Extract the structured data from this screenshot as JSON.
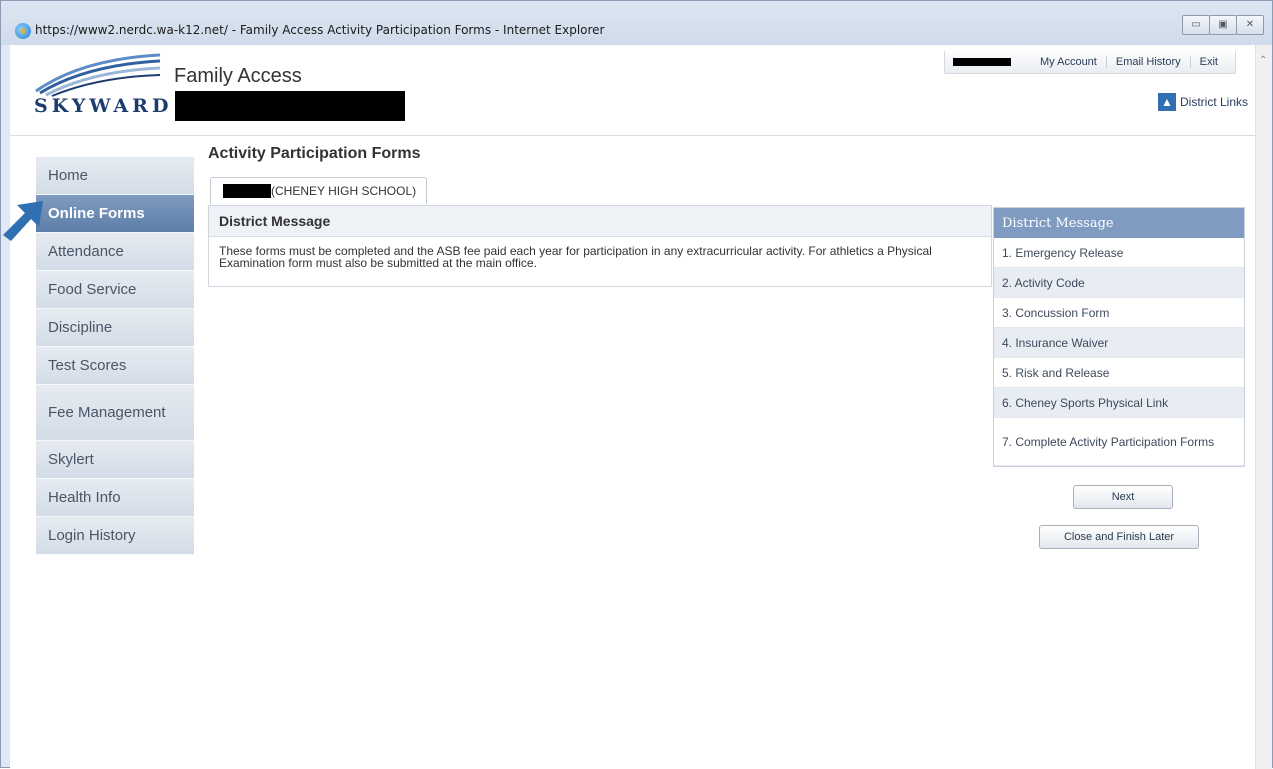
{
  "window": {
    "title": "https://www2.nerdc.wa-k12.net/ - Family Access Activity Participation Forms - Internet Explorer",
    "controls": [
      "▭",
      "▣",
      "✕"
    ]
  },
  "header": {
    "logo_text": "SKYWARD",
    "app_title": "Family Access",
    "links": [
      "My Account",
      "Email History",
      "Exit"
    ],
    "district_links": "District Links"
  },
  "sidebar": {
    "items": [
      {
        "label": "Home",
        "active": false
      },
      {
        "label": "Online Forms",
        "active": true
      },
      {
        "label": "Attendance",
        "active": false
      },
      {
        "label": "Food Service",
        "active": false
      },
      {
        "label": "Discipline",
        "active": false
      },
      {
        "label": "Test Scores",
        "active": false
      },
      {
        "label": "Fee Management",
        "active": false
      },
      {
        "label": "Skylert",
        "active": false
      },
      {
        "label": "Health Info",
        "active": false
      },
      {
        "label": "Login History",
        "active": false
      }
    ]
  },
  "main": {
    "title": "Activity Participation Forms",
    "tab_label": "(CHENEY HIGH SCHOOL)",
    "message_heading": "District Message",
    "message_body": "These forms must be completed and the ASB fee paid each year for participation in any extracurricular activity. For athletics a Physical Examination form must also be submitted at the main office."
  },
  "steps": {
    "header": "District Message",
    "items": [
      "1. Emergency Release",
      "2. Activity Code",
      "3. Concussion Form",
      "4. Insurance Waiver",
      "5. Risk and Release",
      "6. Cheney Sports Physical Link",
      "7. Complete Activity Participation Forms"
    ]
  },
  "buttons": {
    "next": "Next",
    "close": "Close and Finish Later"
  },
  "colors": {
    "accent": "#5d7ea8",
    "steps_header": "#7f9bc1",
    "arrow": "#2f6fb2"
  }
}
